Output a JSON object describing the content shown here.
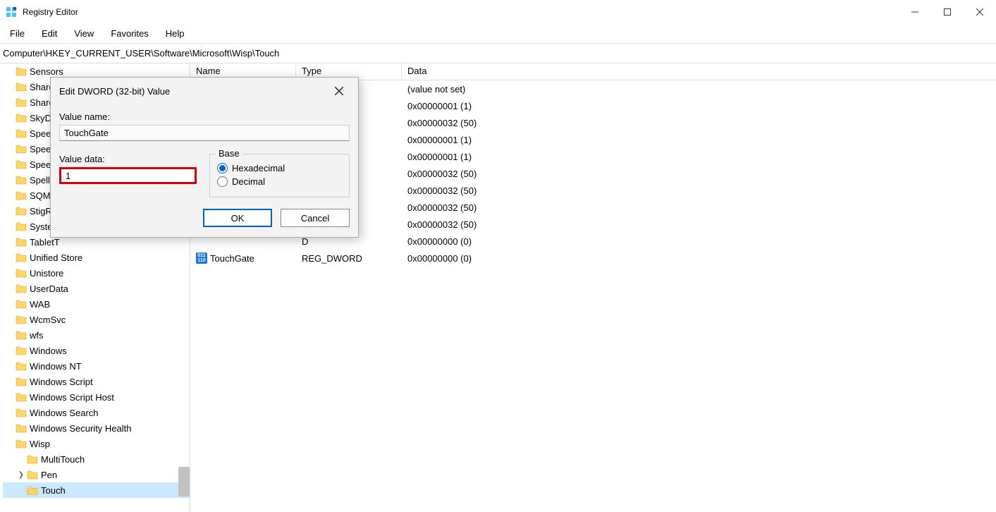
{
  "window": {
    "title": "Registry Editor"
  },
  "menu": {
    "file": "File",
    "edit": "Edit",
    "view": "View",
    "favorites": "Favorites",
    "help": "Help"
  },
  "address": "Computer\\HKEY_CURRENT_USER\\Software\\Microsoft\\Wisp\\Touch",
  "tree": [
    {
      "label": "Sensors",
      "indent": 0,
      "expand": false
    },
    {
      "label": "Shared",
      "indent": 0,
      "expand": false
    },
    {
      "label": "Shared",
      "indent": 0,
      "expand": false
    },
    {
      "label": "SkyDriv",
      "indent": 0,
      "expand": false
    },
    {
      "label": "Speech",
      "indent": 0,
      "expand": false
    },
    {
      "label": "Speech",
      "indent": 0,
      "expand": false
    },
    {
      "label": "Speech",
      "indent": 0,
      "expand": false
    },
    {
      "label": "Spelling",
      "indent": 0,
      "expand": false
    },
    {
      "label": "SQMCli",
      "indent": 0,
      "expand": false
    },
    {
      "label": "StigReg",
      "indent": 0,
      "expand": false
    },
    {
      "label": "System",
      "indent": 0,
      "expand": false
    },
    {
      "label": "TabletT",
      "indent": 0,
      "expand": false
    },
    {
      "label": "Unified Store",
      "indent": 0,
      "expand": false
    },
    {
      "label": "Unistore",
      "indent": 0,
      "expand": false
    },
    {
      "label": "UserData",
      "indent": 0,
      "expand": false
    },
    {
      "label": "WAB",
      "indent": 0,
      "expand": false
    },
    {
      "label": "WcmSvc",
      "indent": 0,
      "expand": false
    },
    {
      "label": "wfs",
      "indent": 0,
      "expand": false
    },
    {
      "label": "Windows",
      "indent": 0,
      "expand": false
    },
    {
      "label": "Windows NT",
      "indent": 0,
      "expand": false
    },
    {
      "label": "Windows Script",
      "indent": 0,
      "expand": false
    },
    {
      "label": "Windows Script Host",
      "indent": 0,
      "expand": false
    },
    {
      "label": "Windows Search",
      "indent": 0,
      "expand": false
    },
    {
      "label": "Windows Security Health",
      "indent": 0,
      "expand": false
    },
    {
      "label": "Wisp",
      "indent": 0,
      "expand": false
    },
    {
      "label": "MultiTouch",
      "indent": 1,
      "expand": false
    },
    {
      "label": "Pen",
      "indent": 1,
      "expand": true
    },
    {
      "label": "Touch",
      "indent": 1,
      "expand": false,
      "selected": true
    }
  ],
  "list": {
    "headers": {
      "name": "Name",
      "type": "Type",
      "data": "Data"
    },
    "rows": [
      {
        "name": "",
        "type": "",
        "data": "(value not set)",
        "hide_icon": true
      },
      {
        "name": "",
        "type": "D",
        "data": "0x00000001 (1)"
      },
      {
        "name": "",
        "type": "D",
        "data": "0x00000032 (50)"
      },
      {
        "name": "",
        "type": "D",
        "data": "0x00000001 (1)"
      },
      {
        "name": "",
        "type": "D",
        "data": "0x00000001 (1)"
      },
      {
        "name": "",
        "type": "D",
        "data": "0x00000032 (50)"
      },
      {
        "name": "",
        "type": "D",
        "data": "0x00000032 (50)"
      },
      {
        "name": "",
        "type": "D",
        "data": "0x00000032 (50)"
      },
      {
        "name": "",
        "type": "D",
        "data": "0x00000032 (50)"
      },
      {
        "name": "",
        "type": "D",
        "data": "0x00000000 (0)"
      },
      {
        "name": "TouchGate",
        "type": "REG_DWORD",
        "data": "0x00000000 (0)",
        "show_icon": true
      }
    ]
  },
  "dialog": {
    "title": "Edit DWORD (32-bit) Value",
    "value_name_label": "Value name:",
    "value_name": "TouchGate",
    "value_data_label": "Value data:",
    "value_data": "1",
    "base_label": "Base",
    "hex_label": "Hexadecimal",
    "dec_label": "Decimal",
    "ok": "OK",
    "cancel": "Cancel"
  }
}
